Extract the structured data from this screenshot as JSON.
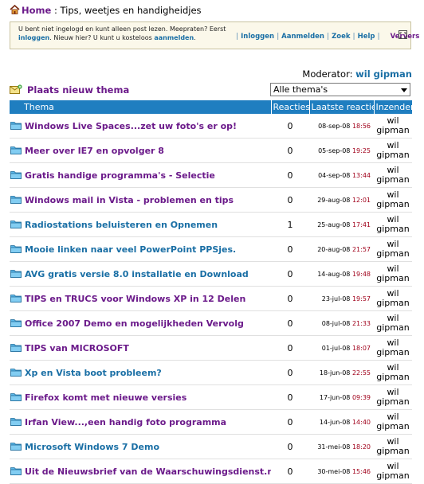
{
  "breadcrumb": {
    "home": "Home",
    "separator": ":",
    "section": "Tips, weetjes en handigheidjes"
  },
  "notice": {
    "text1": "U bent niet ingelogd en kunt alleen post lezen. Meepraten? Eerst",
    "link_login": "inloggen",
    "text2": ". Nieuw hier? U kunt u kosteloos",
    "link_register": "aanmelden",
    "text3": ".",
    "links": [
      "Inloggen",
      "Aanmelden",
      "Zoek",
      "Help"
    ],
    "refresh": "Ververs"
  },
  "moderator": {
    "label": "Moderator:",
    "name": "wil gipman"
  },
  "new_thema": "Plaats nieuw thema",
  "filter": {
    "selected": "Alle thema's"
  },
  "table": {
    "headers": {
      "thema": "Thema",
      "reacties": "Reacties",
      "laatste": "Laatste reactie",
      "inzender": "Inzender"
    },
    "rows": [
      {
        "title": "Windows Live Spaces...zet uw foto's er op!",
        "reacties": "0",
        "date": "08-sep-08",
        "time": "18:56",
        "user": "wil gipman",
        "color": "purple"
      },
      {
        "title": "Meer over IE7 en opvolger 8",
        "reacties": "0",
        "date": "05-sep-08",
        "time": "19:25",
        "user": "wil gipman",
        "color": "purple"
      },
      {
        "title": "Gratis handige programma's - Selectie",
        "reacties": "0",
        "date": "04-sep-08",
        "time": "13:44",
        "user": "wil gipman",
        "color": "purple"
      },
      {
        "title": "Windows mail in Vista - problemen en tips",
        "reacties": "0",
        "date": "29-aug-08",
        "time": "12:01",
        "user": "wil gipman",
        "color": "purple"
      },
      {
        "title": "Radiostations beluisteren en Opnemen",
        "reacties": "1",
        "date": "25-aug-08",
        "time": "17:41",
        "user": "wil gipman",
        "color": "blue"
      },
      {
        "title": "Mooie linken naar veel PowerPoint PPSjes.",
        "reacties": "0",
        "date": "20-aug-08",
        "time": "21:57",
        "user": "wil gipman",
        "color": "blue"
      },
      {
        "title": "AVG gratis versie 8.0 installatie en Download",
        "reacties": "0",
        "date": "14-aug-08",
        "time": "19:48",
        "user": "wil gipman",
        "color": "blue"
      },
      {
        "title": "TIPS en TRUCS voor Windows XP in 12 Delen",
        "reacties": "0",
        "date": "23-jul-08",
        "time": "19:57",
        "user": "wil gipman",
        "color": "purple"
      },
      {
        "title": "Office 2007 Demo en mogelijkheden Vervolg",
        "reacties": "0",
        "date": "08-jul-08",
        "time": "21:33",
        "user": "wil gipman",
        "color": "purple"
      },
      {
        "title": "TIPS van MICROSOFT",
        "reacties": "0",
        "date": "01-jul-08",
        "time": "18:07",
        "user": "wil gipman",
        "color": "purple"
      },
      {
        "title": "Xp en Vista boot probleem?",
        "reacties": "0",
        "date": "18-jun-08",
        "time": "22:55",
        "user": "wil gipman",
        "color": "blue"
      },
      {
        "title": "Firefox komt met nieuwe versies",
        "reacties": "0",
        "date": "17-jun-08",
        "time": "09:39",
        "user": "wil gipman",
        "color": "purple"
      },
      {
        "title": "Irfan View...,een handig foto programma",
        "reacties": "0",
        "date": "14-jun-08",
        "time": "14:40",
        "user": "wil gipman",
        "color": "purple"
      },
      {
        "title": "Microsoft Windows 7 Demo",
        "reacties": "0",
        "date": "31-mei-08",
        "time": "18:20",
        "user": "wil gipman",
        "color": "blue"
      },
      {
        "title": "Uit de Nieuwsbrief van de Waarschuwingsdienst.nl",
        "reacties": "0",
        "date": "30-mei-08",
        "time": "15:46",
        "user": "wil gipman",
        "color": "purple"
      }
    ]
  },
  "colors": {
    "purple_link": "#6b1a8a",
    "blue_link": "#1a6fa5",
    "header_bg": "#1f7ec0",
    "time": "#a0001a"
  }
}
